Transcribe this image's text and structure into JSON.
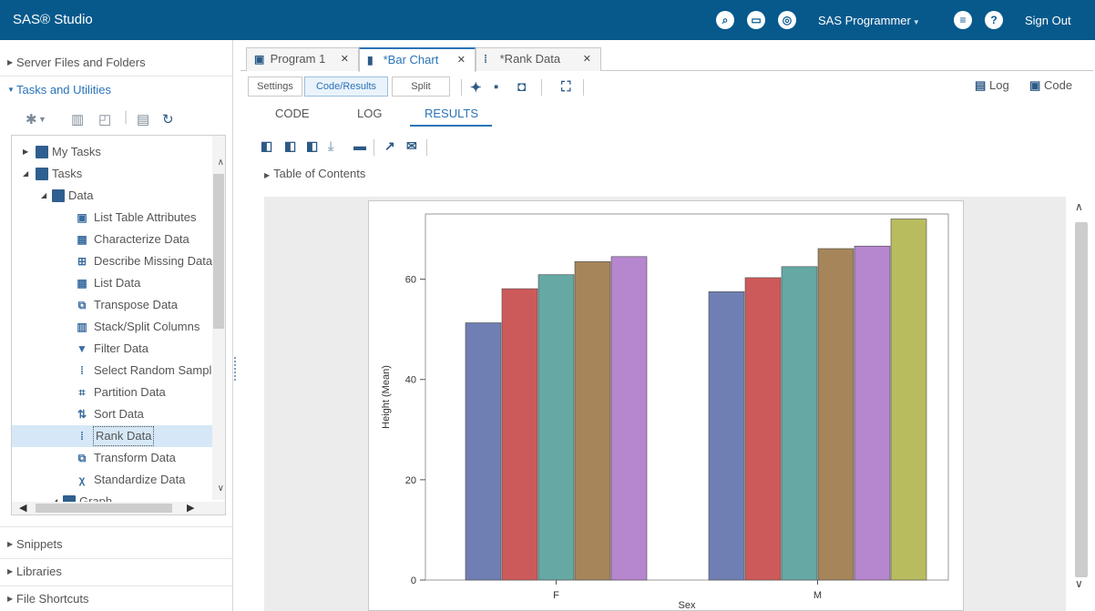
{
  "app": {
    "title": "SAS® Studio",
    "user": "SAS Programmer",
    "sign_out": "Sign Out"
  },
  "left": {
    "sections": {
      "server_files": "Server Files and Folders",
      "tasks_utilities": "Tasks and Utilities",
      "snippets": "Snippets",
      "libraries": "Libraries",
      "file_shortcuts": "File Shortcuts"
    },
    "tree": {
      "my_tasks": "My Tasks",
      "tasks": "Tasks",
      "data": "Data",
      "items": [
        "List Table Attributes",
        "Characterize Data",
        "Describe Missing Data",
        "List Data",
        "Transpose Data",
        "Stack/Split Columns",
        "Filter Data",
        "Select Random Sample",
        "Partition Data",
        "Sort Data",
        "Rank Data",
        "Transform Data",
        "Standardize Data"
      ],
      "graph": "Graph",
      "selected": "Rank Data"
    }
  },
  "tabs": [
    {
      "label": "Program 1",
      "icon": "program-icon"
    },
    {
      "label": "*Bar Chart",
      "icon": "bar-chart-icon"
    },
    {
      "label": "*Rank Data",
      "icon": "rank-icon"
    }
  ],
  "modes": {
    "settings": "Settings",
    "code_results": "Code/Results",
    "split": "Split",
    "log": "Log",
    "code": "Code"
  },
  "subtabs": {
    "code": "CODE",
    "log": "LOG",
    "results": "RESULTS"
  },
  "toc": "Table of Contents",
  "colors": {
    "header": "#07598c",
    "accent": "#2a73b8",
    "series": [
      "#6f7fb3",
      "#cd5a5a",
      "#66a8a3",
      "#a6855a",
      "#b686cf",
      "#b9bc5e"
    ]
  },
  "chart_data": {
    "type": "bar",
    "title": "",
    "xlabel": "Sex",
    "ylabel": "Height (Mean)",
    "categories": [
      "F",
      "M"
    ],
    "yticks": [
      "0",
      "20",
      "40",
      "60"
    ],
    "ylim": [
      0,
      73
    ],
    "grid": false,
    "legend": "none",
    "series": [
      {
        "values": [
          51.3,
          57.5
        ]
      },
      {
        "values": [
          58.1,
          60.3
        ]
      },
      {
        "values": [
          60.9,
          62.5
        ]
      },
      {
        "values": [
          63.5,
          66.1
        ]
      },
      {
        "values": [
          64.5,
          66.6
        ]
      },
      {
        "values": [
          null,
          72.0
        ]
      }
    ]
  }
}
